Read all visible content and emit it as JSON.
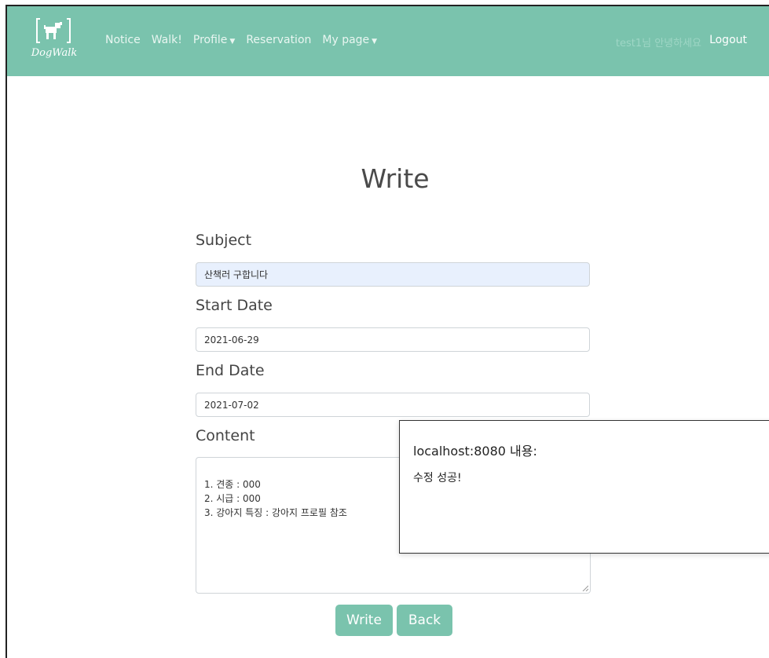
{
  "nav": {
    "brand": "DogWalk",
    "items": [
      {
        "label": "Notice"
      },
      {
        "label": "Walk!"
      },
      {
        "label": "Profile",
        "dropdown": true
      },
      {
        "label": "Reservation"
      },
      {
        "label": "My page",
        "dropdown": true
      }
    ],
    "greeting": "test1님 안녕하세요",
    "logout": "Logout"
  },
  "form": {
    "title": "Write",
    "subject_label": "Subject",
    "subject_value": "산책러 구합니다",
    "start_label": "Start Date",
    "start_value": "2021-06-29",
    "end_label": "End Date",
    "end_value": "2021-07-02",
    "content_label": "Content",
    "content_value": "1. 견종 : 000\n2. 시급 : 000\n3. 강아지 특징 : 강아지 프로필 참조",
    "write_button": "Write",
    "back_button": "Back"
  },
  "dialog": {
    "title": "localhost:8080 내용:",
    "message": "수정 성공!"
  },
  "colors": {
    "accent": "#7ac3ad",
    "autofill": "#e8f0fd"
  }
}
